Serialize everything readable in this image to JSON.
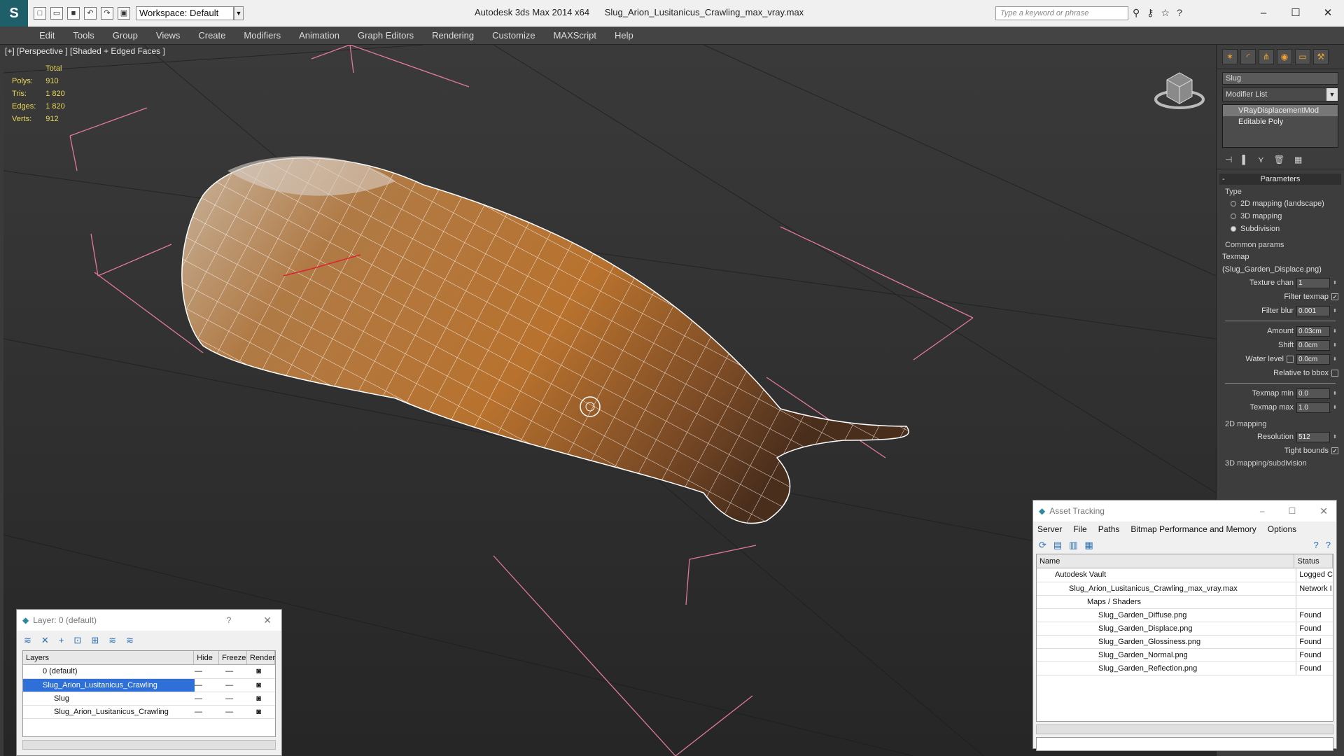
{
  "titlebar": {
    "app_title": "Autodesk 3ds Max  2014 x64",
    "file_name": "Slug_Arion_Lusitanicus_Crawling_max_vray.max",
    "workspace": "Workspace: Default",
    "search_placeholder": "Type a keyword or phrase"
  },
  "menu": [
    "Edit",
    "Tools",
    "Group",
    "Views",
    "Create",
    "Modifiers",
    "Animation",
    "Graph Editors",
    "Rendering",
    "Customize",
    "MAXScript",
    "Help"
  ],
  "viewport": {
    "label": "[+] [Perspective ] [Shaded + Edged Faces ]",
    "stats_header": "Total",
    "stats": [
      {
        "label": "Polys:",
        "value": "910"
      },
      {
        "label": "Tris:",
        "value": "1 820"
      },
      {
        "label": "Edges:",
        "value": "1 820"
      },
      {
        "label": "Verts:",
        "value": "912"
      }
    ]
  },
  "command_panel": {
    "object_name": "Slug",
    "modifier_list": "Modifier List",
    "stack": [
      "VRayDisplacementMod",
      "Editable Poly"
    ],
    "rollout_title": "Parameters",
    "type_label": "Type",
    "type_options": [
      {
        "label": "2D mapping (landscape)",
        "selected": false
      },
      {
        "label": "3D mapping",
        "selected": false
      },
      {
        "label": "Subdivision",
        "selected": true
      }
    ],
    "common_params": "Common params",
    "texmap_label": "Texmap",
    "texmap_value": "(Slug_Garden_Displace.png)",
    "texture_chan_label": "Texture chan",
    "texture_chan": "1",
    "filter_texmap_label": "Filter texmap",
    "filter_blur_label": "Filter blur",
    "filter_blur": "0.001",
    "amount_label": "Amount",
    "amount": "0.03cm",
    "shift_label": "Shift",
    "shift": "0.0cm",
    "water_level_label": "Water level",
    "water_level": "0.0cm",
    "relative_bbox_label": "Relative to bbox",
    "texmap_min_label": "Texmap min",
    "texmap_min": "0.0",
    "texmap_max_label": "Texmap max",
    "texmap_max": "1.0",
    "mapping2d_label": "2D mapping",
    "resolution_label": "Resolution",
    "resolution": "512",
    "tight_bounds_label": "Tight bounds",
    "mapping3d_label": "3D mapping/subdivision"
  },
  "layer_panel": {
    "title": "Layer: 0 (default)",
    "help": "?",
    "columns": [
      "Layers",
      "Hide",
      "Freeze",
      "Render"
    ],
    "rows": [
      {
        "name": "0 (default)",
        "selected": false
      },
      {
        "name": "Slug_Arion_Lusitanicus_Crawling",
        "selected": true
      },
      {
        "name": "Slug",
        "selected": false
      },
      {
        "name": "Slug_Arion_Lusitanicus_Crawling",
        "selected": false
      }
    ]
  },
  "asset_panel": {
    "title": "Asset Tracking",
    "menu": [
      "Server",
      "File",
      "Paths",
      "Bitmap Performance and Memory",
      "Options"
    ],
    "columns": [
      "Name",
      "Status"
    ],
    "rows": [
      {
        "name": "Autodesk Vault",
        "status": "Logged C"
      },
      {
        "name": "Slug_Arion_Lusitanicus_Crawling_max_vray.max",
        "status": "Network I"
      },
      {
        "name": "Maps / Shaders",
        "status": ""
      },
      {
        "name": "Slug_Garden_Diffuse.png",
        "status": "Found"
      },
      {
        "name": "Slug_Garden_Displace.png",
        "status": "Found"
      },
      {
        "name": "Slug_Garden_Glossiness.png",
        "status": "Found"
      },
      {
        "name": "Slug_Garden_Normal.png",
        "status": "Found"
      },
      {
        "name": "Slug_Garden_Reflection.png",
        "status": "Found"
      }
    ]
  }
}
